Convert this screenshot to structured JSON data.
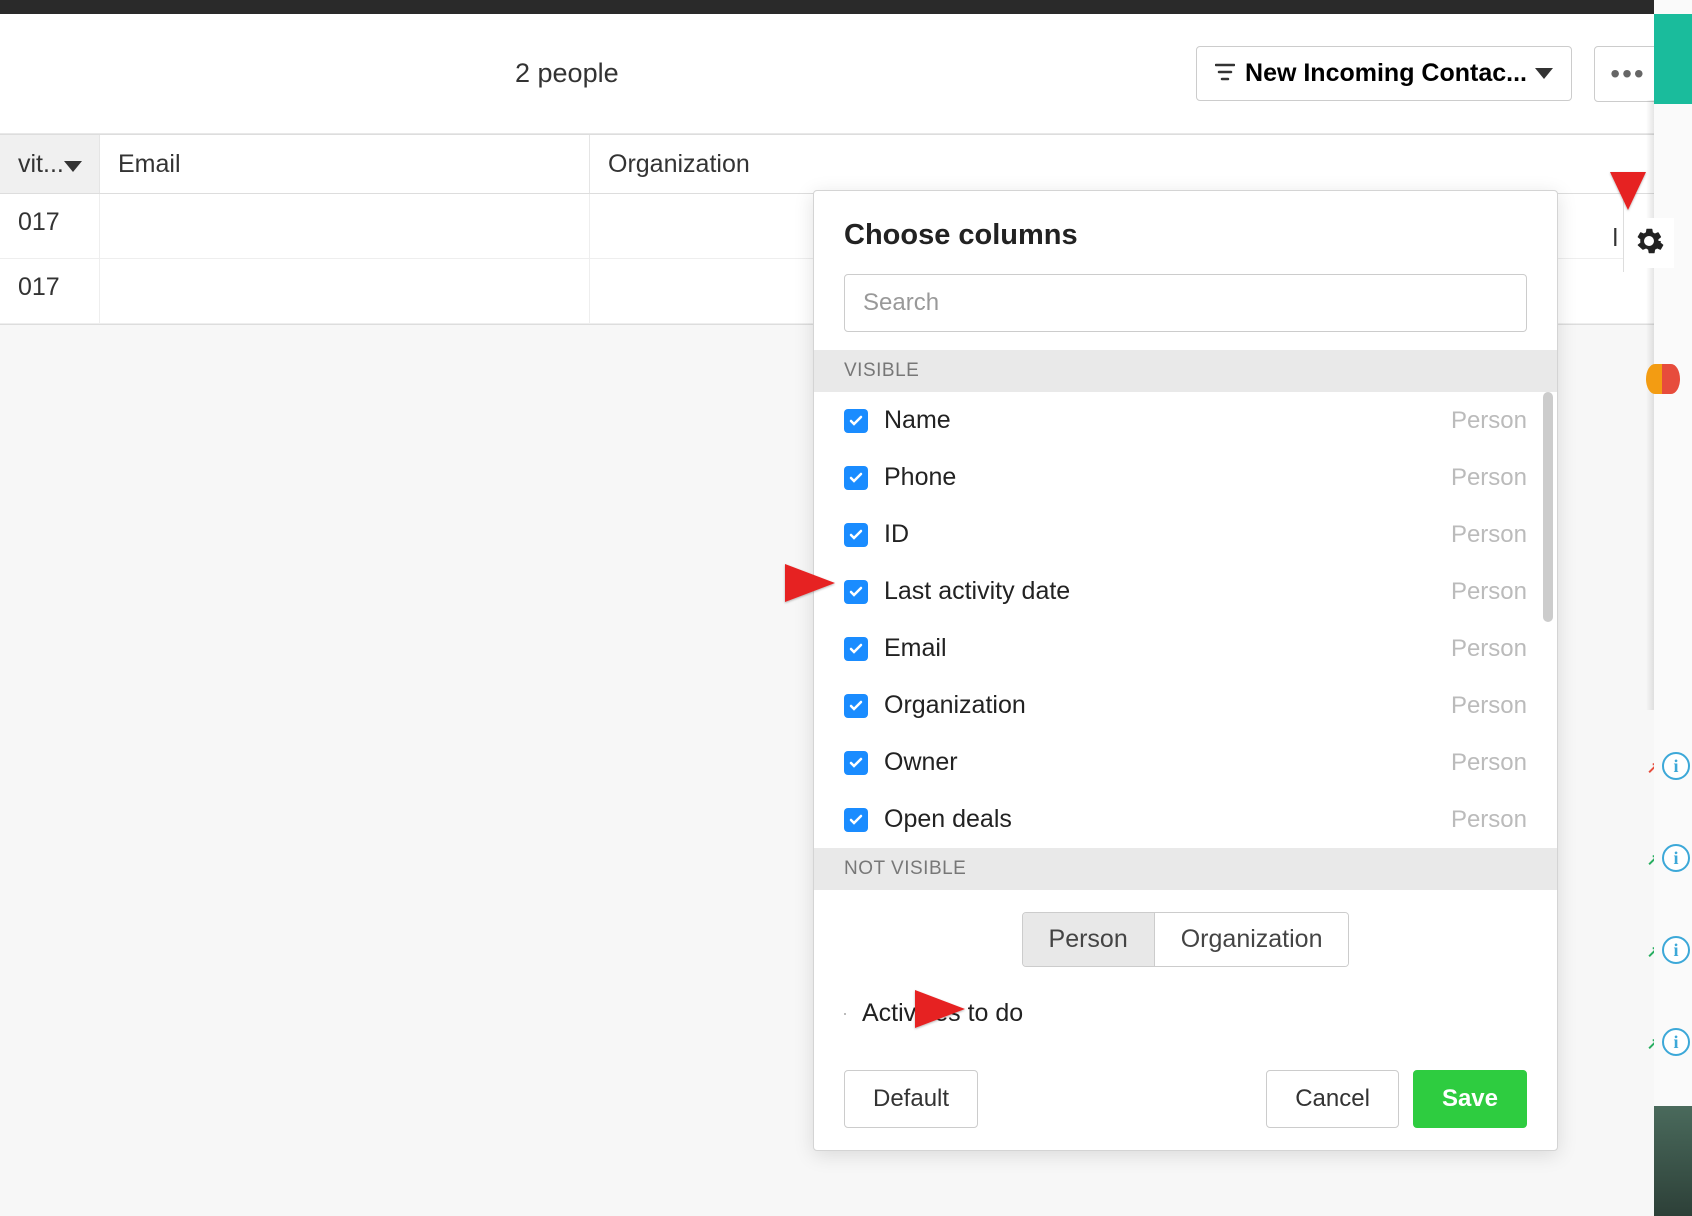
{
  "header": {
    "people_count": "2 people",
    "filter_label": "New Incoming Contac...",
    "more_dots": "•••"
  },
  "table": {
    "columns": {
      "activity": "vit...",
      "email": "Email",
      "organization": "Organization",
      "hidden_letter": "l"
    },
    "rows": [
      {
        "activity": "017",
        "email": "",
        "organization": ""
      },
      {
        "activity": "017",
        "email": "",
        "organization": ""
      }
    ]
  },
  "popover": {
    "title": "Choose columns",
    "search_placeholder": "Search",
    "section_visible": "VISIBLE",
    "section_not_visible": "NOT VISIBLE",
    "visible_items": [
      {
        "label": "Name",
        "category": "Person",
        "checked": true
      },
      {
        "label": "Phone",
        "category": "Person",
        "checked": true
      },
      {
        "label": "ID",
        "category": "Person",
        "checked": true
      },
      {
        "label": "Last activity date",
        "category": "Person",
        "checked": true
      },
      {
        "label": "Email",
        "category": "Person",
        "checked": true
      },
      {
        "label": "Organization",
        "category": "Person",
        "checked": true
      },
      {
        "label": "Owner",
        "category": "Person",
        "checked": true
      },
      {
        "label": "Open deals",
        "category": "Person",
        "checked": true
      }
    ],
    "toggle": {
      "person": "Person",
      "organization": "Organization"
    },
    "not_visible_items": [
      {
        "label": "Activities to do",
        "checked": false
      }
    ],
    "buttons": {
      "default": "Default",
      "cancel": "Cancel",
      "save": "Save"
    }
  }
}
